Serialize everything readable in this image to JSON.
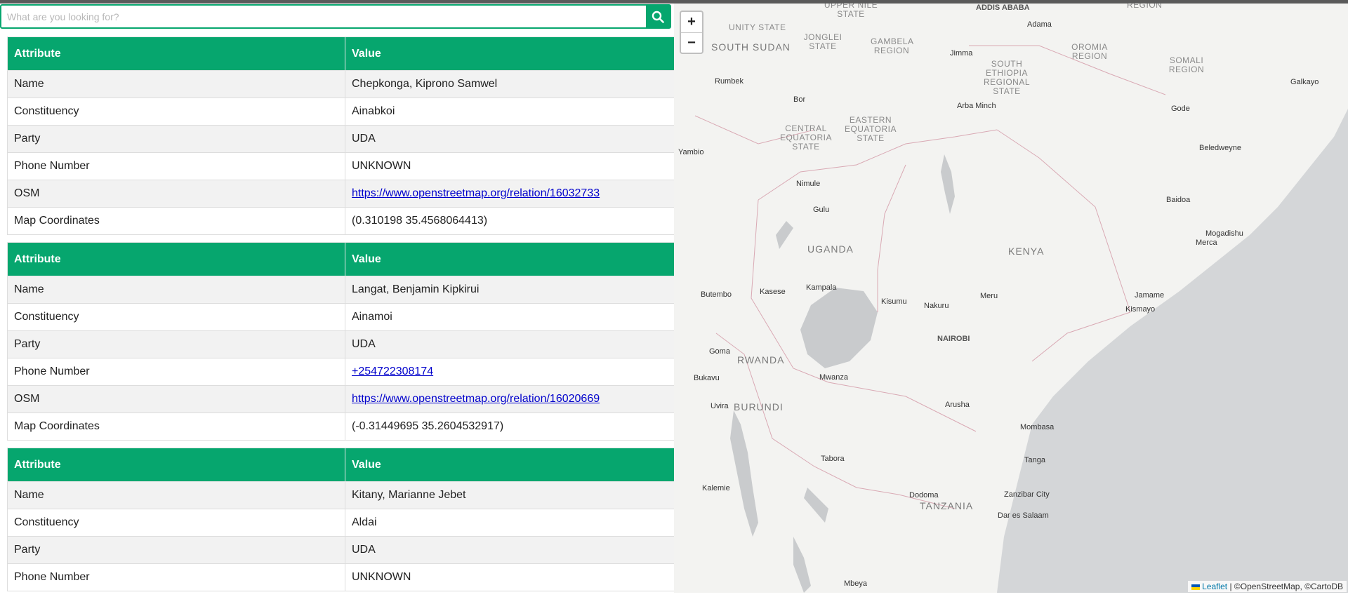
{
  "search": {
    "placeholder": "What are you looking for?"
  },
  "table_header": {
    "attribute": "Attribute",
    "value": "Value"
  },
  "records": [
    {
      "rows": [
        {
          "attribute": "Name",
          "value": "Chepkonga, Kiprono Samwel"
        },
        {
          "attribute": "Constituency",
          "value": "Ainabkoi"
        },
        {
          "attribute": "Party",
          "value": "UDA"
        },
        {
          "attribute": "Phone Number",
          "value": "UNKNOWN"
        },
        {
          "attribute": "OSM",
          "value": "https://www.openstreetmap.org/relation/16032733",
          "link": true
        },
        {
          "attribute": "Map Coordinates",
          "value": "(0.310198 35.4568064413)"
        }
      ]
    },
    {
      "rows": [
        {
          "attribute": "Name",
          "value": "Langat, Benjamin Kipkirui"
        },
        {
          "attribute": "Constituency",
          "value": "Ainamoi"
        },
        {
          "attribute": "Party",
          "value": "UDA"
        },
        {
          "attribute": "Phone Number",
          "value": "+254722308174",
          "link": true
        },
        {
          "attribute": "OSM",
          "value": "https://www.openstreetmap.org/relation/16020669",
          "link": true
        },
        {
          "attribute": "Map Coordinates",
          "value": "(-0.31449695 35.2604532917)"
        }
      ]
    },
    {
      "rows": [
        {
          "attribute": "Name",
          "value": "Kitany, Marianne Jebet"
        },
        {
          "attribute": "Constituency",
          "value": "Aldai"
        },
        {
          "attribute": "Party",
          "value": "UDA"
        },
        {
          "attribute": "Phone Number",
          "value": "UNKNOWN"
        }
      ]
    }
  ],
  "map": {
    "zoom_in": "+",
    "zoom_out": "−",
    "attribution": {
      "leaflet": "Leaflet",
      "rest": " | ©OpenStreetMap, ©CartoDB"
    },
    "countries": [
      "KENYA",
      "UGANDA",
      "RWANDA",
      "BURUNDI",
      "TANZANIA",
      "SOUTH SUDAN"
    ],
    "regions": [
      "UNITY STATE",
      "JONGLEI STATE",
      "GAMBELA REGION",
      "UPPER NILE STATE",
      "OROMIA REGION",
      "SOMALI REGION",
      "SOUTH ETHIOPIA REGIONAL STATE",
      "CENTRAL EQUATORIA STATE",
      "EASTERN EQUATORIA STATE",
      "REGION"
    ],
    "cities": [
      "ADDIS ABABA",
      "Adama",
      "Jimma",
      "Arba Minch",
      "Galkayo",
      "Gode",
      "Beledweyne",
      "Baidoa",
      "Mogadishu",
      "Merca",
      "Jamame",
      "Kismayo",
      "Rumbek",
      "Bor",
      "Yambio",
      "Nimule",
      "Gulu",
      "Kasese",
      "Butembo",
      "Kampala",
      "Kisumu",
      "Nakuru",
      "Meru",
      "NAIROBI",
      "Goma",
      "Bukavu",
      "Mwanza",
      "Uvira",
      "Arusha",
      "Mombasa",
      "Tabora",
      "Tanga",
      "Kalemie",
      "Dodoma",
      "Zanzibar City",
      "Dar es Salaam",
      "Mbeya"
    ]
  },
  "colors": {
    "accent": "#06a66e",
    "water": "#d4d6d8",
    "land": "#f3f3f1"
  }
}
